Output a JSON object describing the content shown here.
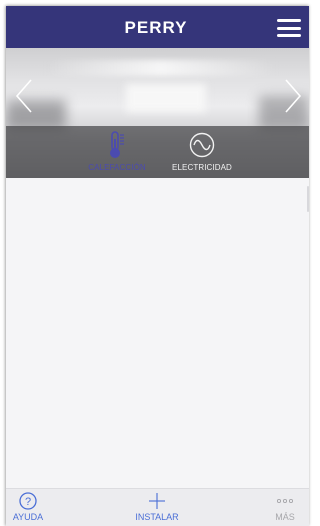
{
  "header": {
    "logo_text": "PERRY",
    "menu_icon": "hamburger-menu-icon",
    "background": "#35357a"
  },
  "hero": {
    "prev_icon": "chevron-left-icon",
    "next_icon": "chevron-right-icon",
    "categories": [
      {
        "label": "CALEFACCIÓN",
        "icon": "thermometer-icon",
        "active": true,
        "color": "#4b4bb0"
      },
      {
        "label": "ELECTRICIDAD",
        "icon": "electricity-wave-icon",
        "active": false,
        "color": "#f2f2f2"
      }
    ]
  },
  "tabbar": {
    "items": [
      {
        "label": "AYUDA",
        "icon": "help-icon"
      },
      {
        "label": "INSTALAR",
        "icon": "plus-icon"
      },
      {
        "label": "MÁS",
        "icon": "more-icon"
      }
    ],
    "accent": "#4a6ed6"
  }
}
